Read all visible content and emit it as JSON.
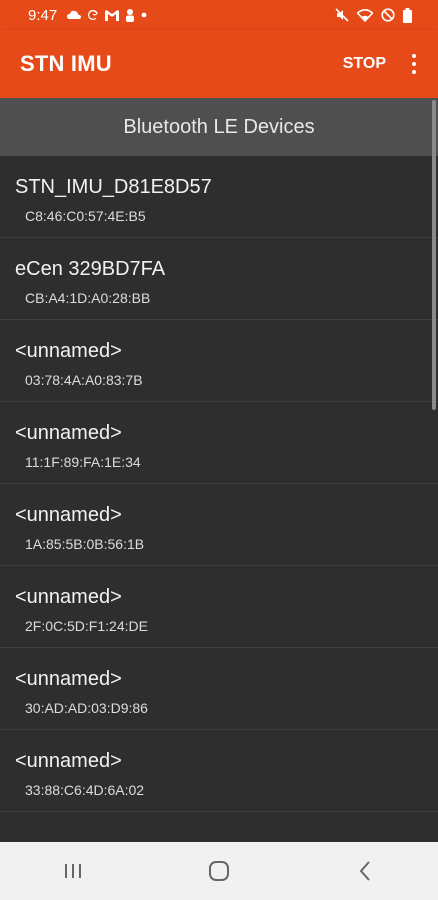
{
  "status_bar": {
    "time": "9:47",
    "left_icons": [
      "cloud-icon",
      "google-icon",
      "gmail-icon",
      "person-icon",
      "dot-icon"
    ],
    "right_icons": [
      "mute-icon",
      "wifi-icon",
      "do-not-disturb-icon",
      "battery-icon"
    ]
  },
  "app_bar": {
    "title": "STN IMU",
    "stop_label": "STOP"
  },
  "section": {
    "title": "Bluetooth LE Devices"
  },
  "devices": [
    {
      "name": "STN_IMU_D81E8D57",
      "address": "C8:46:C0:57:4E:B5"
    },
    {
      "name": "eCen 329BD7FA",
      "address": "CB:A4:1D:A0:28:BB"
    },
    {
      "name": "<unnamed>",
      "address": "03:78:4A:A0:83:7B"
    },
    {
      "name": "<unnamed>",
      "address": "11:1F:89:FA:1E:34"
    },
    {
      "name": "<unnamed>",
      "address": "1A:85:5B:0B:56:1B"
    },
    {
      "name": "<unnamed>",
      "address": "2F:0C:5D:F1:24:DE"
    },
    {
      "name": "<unnamed>",
      "address": "30:AD:AD:03:D9:86"
    },
    {
      "name": "<unnamed>",
      "address": "33:88:C6:4D:6A:02"
    },
    {
      "name": "",
      "address": ""
    }
  ],
  "colors": {
    "accent": "#e64a19",
    "background": "#2e2e2e",
    "header": "#4f4f4f",
    "navbar": "#f1f1f1"
  }
}
